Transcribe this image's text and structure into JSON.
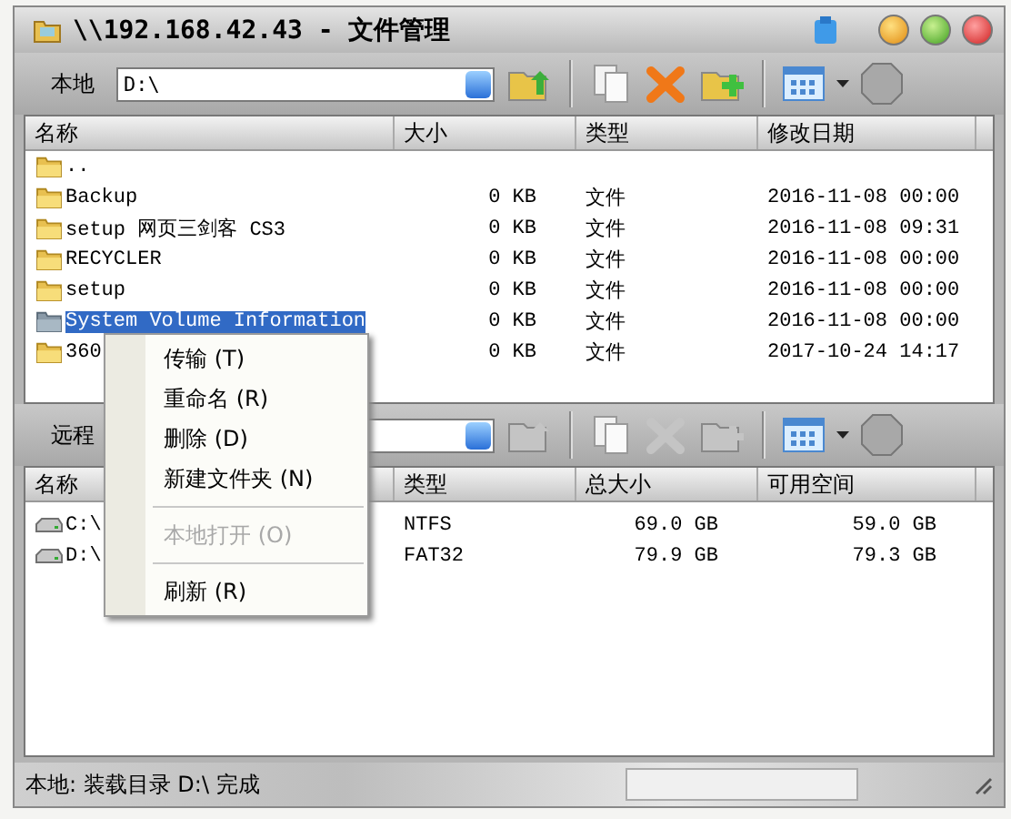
{
  "window": {
    "title": "\\\\192.168.42.43 - 文件管理"
  },
  "local": {
    "label": "本地",
    "path": "D:\\",
    "toolbar_disabled": false
  },
  "local_list": {
    "columns": [
      "名称",
      "大小",
      "类型",
      "修改日期"
    ],
    "rows": [
      {
        "name": "..",
        "size": "",
        "type": "",
        "modified": "",
        "selected": false
      },
      {
        "name": "Backup",
        "size": "0 KB",
        "type": "文件",
        "modified": "2016-11-08 00:00",
        "selected": false
      },
      {
        "name": "setup 网页三剑客 CS3",
        "size": "0 KB",
        "type": "文件",
        "modified": "2016-11-08 09:31",
        "selected": false
      },
      {
        "name": "RECYCLER",
        "size": "0 KB",
        "type": "文件",
        "modified": "2016-11-08 00:00",
        "selected": false
      },
      {
        "name": "setup",
        "size": "0 KB",
        "type": "文件",
        "modified": "2016-11-08 00:00",
        "selected": false
      },
      {
        "name": "System Volume Information",
        "size": "0 KB",
        "type": "文件",
        "modified": "2016-11-08 00:00",
        "selected": true
      },
      {
        "name": "360",
        "size": "0 KB",
        "type": "文件",
        "modified": "2017-10-24 14:17",
        "selected": false
      }
    ]
  },
  "remote": {
    "label": "远程",
    "toolbar_disabled": true
  },
  "remote_list": {
    "columns": [
      "名称",
      "类型",
      "总大小",
      "可用空间"
    ],
    "rows": [
      {
        "name": "C:\\",
        "type": "NTFS",
        "total": "69.0 GB",
        "free": "59.0 GB"
      },
      {
        "name": "D:\\",
        "type": "FAT32",
        "total": "79.9 GB",
        "free": "79.3 GB"
      }
    ]
  },
  "context_menu": [
    {
      "kind": "item",
      "label": "传输 (T)",
      "disabled": false
    },
    {
      "kind": "item",
      "label": "重命名 (R)",
      "disabled": false
    },
    {
      "kind": "item",
      "label": "删除 (D)",
      "disabled": false
    },
    {
      "kind": "item",
      "label": "新建文件夹 (N)",
      "disabled": false
    },
    {
      "kind": "separator"
    },
    {
      "kind": "item",
      "label": "本地打开 (O)",
      "disabled": true
    },
    {
      "kind": "separator"
    },
    {
      "kind": "item",
      "label": "刷新 (R)",
      "disabled": false
    }
  ],
  "status_bar": {
    "text": "本地: 装载目录 D:\\ 完成",
    "progress": {
      "level": 0
    }
  }
}
